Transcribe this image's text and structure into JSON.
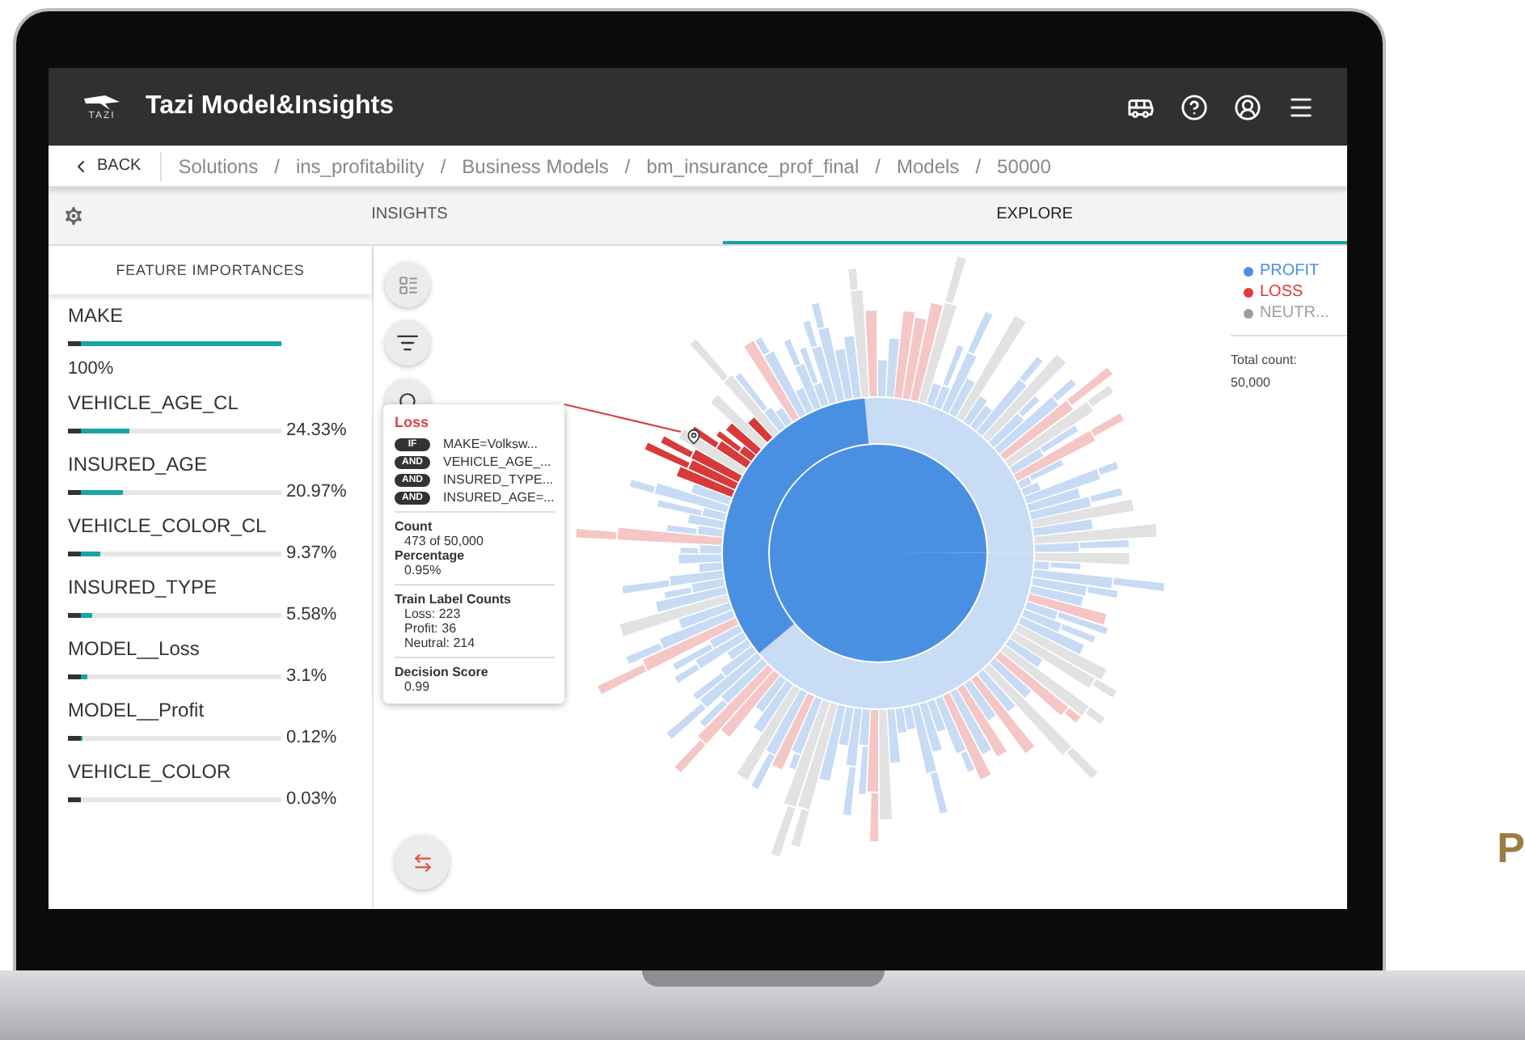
{
  "app": {
    "title": "Tazi Model&Insights",
    "logo_text": "TAZI"
  },
  "breadcrumb": {
    "back": "BACK",
    "separator": "/",
    "items": [
      "Solutions",
      "ins_profitability",
      "Business Models",
      "bm_insurance_prof_final",
      "Models",
      "50000"
    ]
  },
  "tabs": [
    {
      "label": "INSIGHTS",
      "selected": false
    },
    {
      "label": "EXPLORE",
      "selected": true
    }
  ],
  "feature_panel": {
    "title": "FEATURE IMPORTANCES",
    "features": [
      {
        "name": "MAKE",
        "value": "100%",
        "level": 1
      },
      {
        "name": "VEHICLE_AGE_CL",
        "value": "24.33%",
        "level": 0.2433
      },
      {
        "name": "INSURED_AGE",
        "value": "20.97%",
        "level": 0.2097
      },
      {
        "name": "VEHICLE_COLOR_CL",
        "value": "9.37%",
        "level": 0.0937
      },
      {
        "name": "INSURED_TYPE",
        "value": "5.58%",
        "level": 0.0558
      },
      {
        "name": "MODEL__Loss",
        "value": "3.1%",
        "level": 0.031
      },
      {
        "name": "MODEL__Profit",
        "value": "0.12%",
        "level": 0.0012
      },
      {
        "name": "VEHICLE_COLOR",
        "value": "0.03%",
        "level": 0.0003
      }
    ]
  },
  "legend": {
    "items": [
      {
        "label": "PROFIT",
        "color": "#4a90e2"
      },
      {
        "label": "LOSS",
        "color": "#e03a3a"
      },
      {
        "label": "NEUTR...",
        "color": "#9e9e9e"
      }
    ],
    "total_label": "Total count:",
    "total_value": "50,000"
  },
  "tooltip": {
    "title": "Loss",
    "conditions": [
      {
        "op": "IF",
        "text": "MAKE=Volksw..."
      },
      {
        "op": "AND",
        "text": "VEHICLE_AGE_..."
      },
      {
        "op": "AND",
        "text": "INSURED_TYPE..."
      },
      {
        "op": "AND",
        "text": "INSURED_AGE=..."
      }
    ],
    "sections": [
      {
        "lines": [
          {
            "label": "Count",
            "value": "473 of 50,000"
          },
          {
            "label": "Percentage",
            "value": "0.95%"
          }
        ]
      },
      {
        "lines": [
          {
            "label": "Train Label Counts",
            "values": [
              "Loss: 223",
              "Profit: 36",
              "Neutral: 214"
            ]
          }
        ]
      },
      {
        "lines": [
          {
            "label": "Decision Score",
            "value": "0.99"
          }
        ]
      }
    ]
  },
  "side_text": "P"
}
